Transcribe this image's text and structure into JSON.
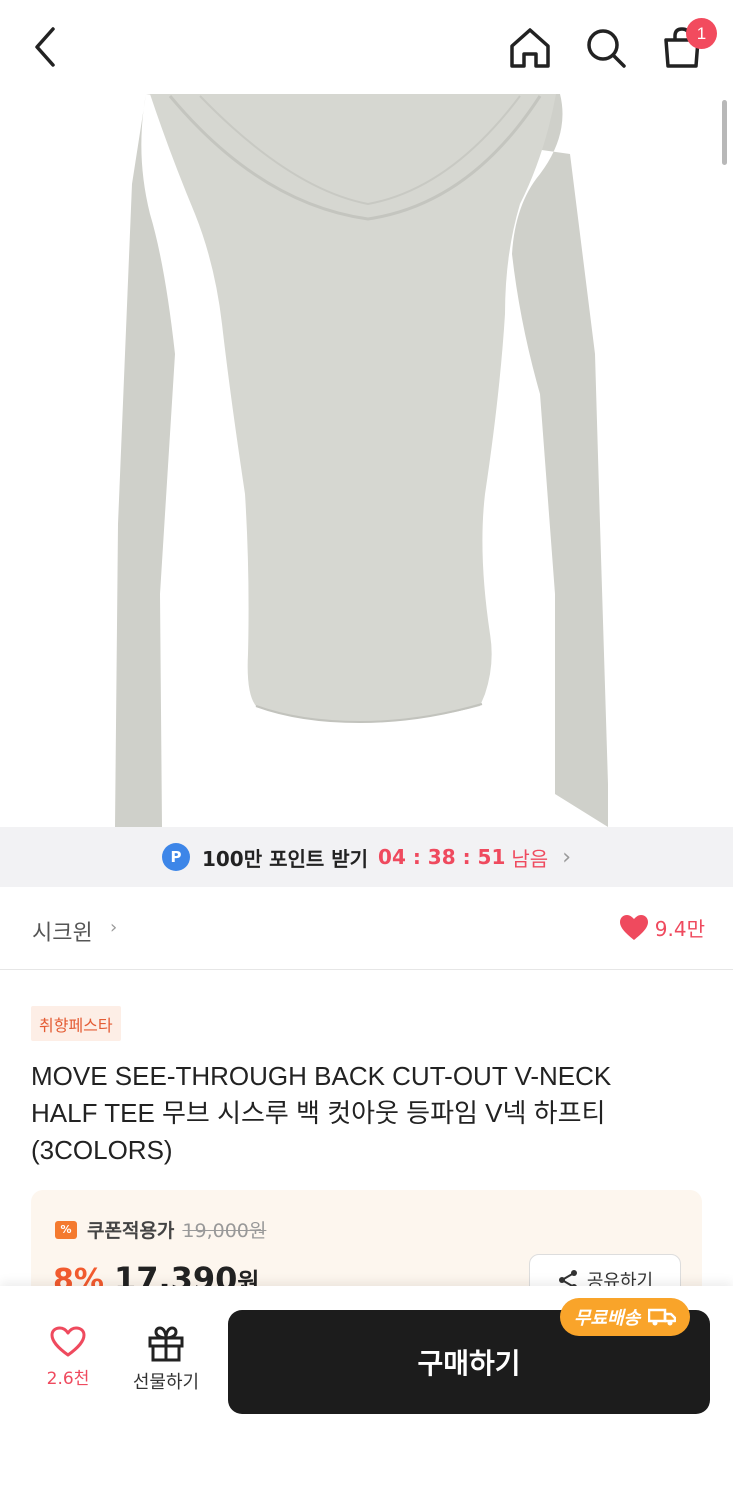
{
  "header": {
    "back_icon": "chevron-left-icon",
    "home_icon": "home-icon",
    "search_icon": "search-icon",
    "cart_icon": "shopping-bag-icon",
    "cart_count": "1"
  },
  "point_banner": {
    "icon_letter": "P",
    "text": "100만 포인트 받기",
    "timer": "04 : 38 : 51",
    "suffix": "남음"
  },
  "brand": {
    "name": "시크윈",
    "like_count": "9.4만"
  },
  "product": {
    "event_tag": "취향페스타",
    "title": "MOVE SEE-THROUGH BACK CUT-OUT  V-NECK HALF TEE 무브 시스루 백 컷아웃 등파임 V넥 하프티 (3COLORS)"
  },
  "price": {
    "coupon_icon": "%",
    "coupon_label": "쿠폰적용가",
    "original_price": "19,000원",
    "discount": "8%",
    "final_price": "17,390",
    "currency": "원",
    "share_label": "공유하기"
  },
  "bottom_bar": {
    "wish_count": "2.6천",
    "gift_label": "선물하기",
    "buy_label": "구매하기",
    "free_shipping": "무료배송"
  },
  "colors": {
    "accent_red": "#ef4a5e",
    "accent_orange": "#f25b2f",
    "buy_button": "#1c1c1c",
    "free_ship_badge": "#f9a42a"
  }
}
